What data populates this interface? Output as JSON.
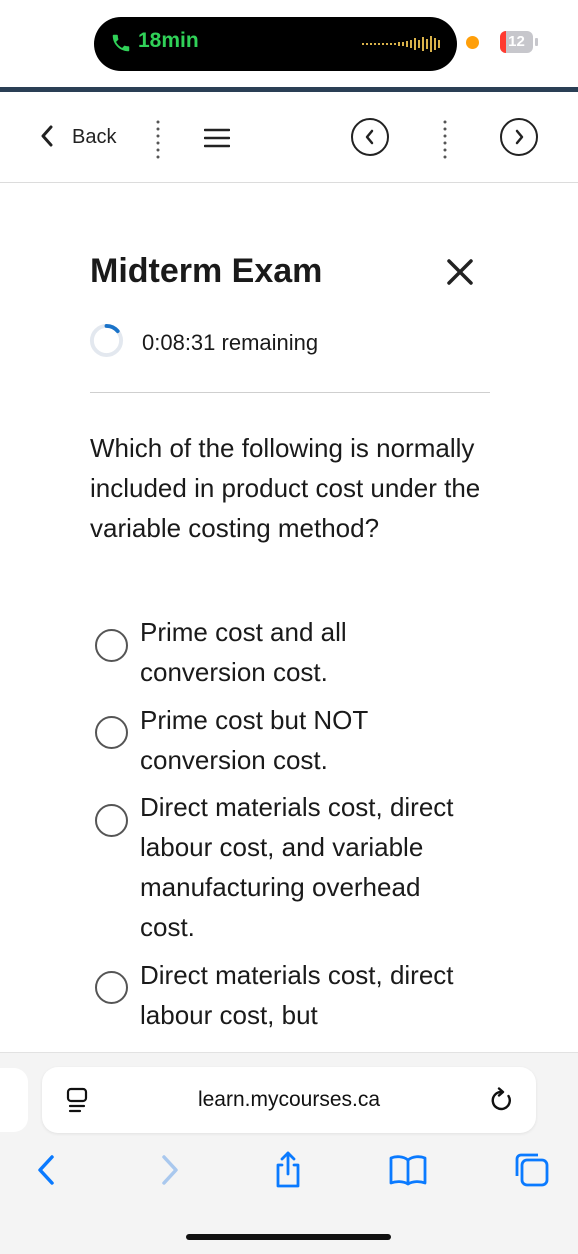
{
  "status_bar": {
    "call_time": "18min",
    "battery_level": "12",
    "icons": [
      "phone-icon",
      "audio-wave-icon",
      "recording-dot-icon",
      "battery-icon"
    ]
  },
  "toolbar": {
    "back_label": "Back",
    "icons": [
      "chevron-left-icon",
      "vertical-dots-icon",
      "menu-icon",
      "prev-question-icon",
      "next-question-icon"
    ]
  },
  "exam": {
    "title": "Midterm Exam",
    "timer": "0:08:31",
    "timer_suffix": "remaining",
    "question": "Which of the following is normally included in product cost under the variable costing method?",
    "options": [
      {
        "label": "Prime cost and all conversion cost.",
        "selected": false
      },
      {
        "label": "Prime cost but NOT conversion cost.",
        "selected": false
      },
      {
        "label": "Direct materials cost, direct labour cost, and variable manufacturing overhead cost.",
        "selected": false
      },
      {
        "label": "Direct materials cost, direct labour cost, but",
        "selected": false
      }
    ]
  },
  "browser": {
    "url": "learn.mycourses.ca",
    "icons": [
      "reader-icon",
      "reload-icon",
      "back-icon",
      "forward-icon",
      "share-icon",
      "bookmarks-icon",
      "tabs-icon"
    ]
  },
  "colors": {
    "call_green": "#30d158",
    "accent_blue": "#0a7aff",
    "header_rule": "#2a3f55",
    "timer_progress": "#1a73c9"
  }
}
